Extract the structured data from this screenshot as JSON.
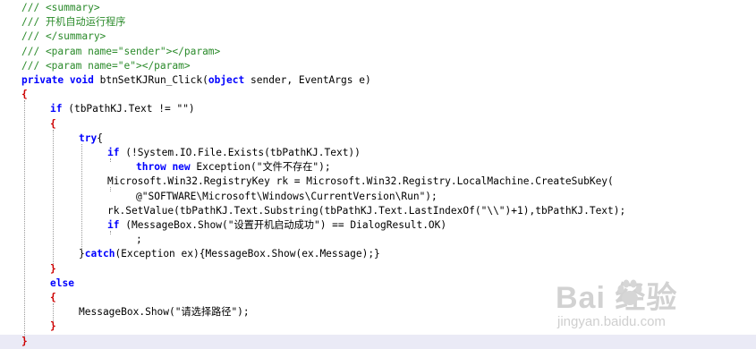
{
  "editor": {
    "lines": [
      "/// <summary>",
      "/// 开机自动运行程序",
      "/// </summary>",
      "/// <param name=\"sender\"></param>",
      "/// <param name=\"e\"></param>",
      "private void btnSetKJRun_Click(object sender, EventArgs e)",
      "{",
      "if (tbPathKJ.Text != \"\")",
      "{",
      "try{",
      "if (!System.IO.File.Exists(tbPathKJ.Text))",
      "throw new Exception(\"文件不存在\");",
      "Microsoft.Win32.RegistryKey rk = Microsoft.Win32.Registry.LocalMachine.CreateSubKey(",
      "@\"SOFTWARE\\Microsoft\\Windows\\CurrentVersion\\Run\");",
      "rk.SetValue(tbPathKJ.Text.Substring(tbPathKJ.Text.LastIndexOf(\"\\\\\")+1),tbPathKJ.Text);",
      "if (MessageBox.Show(\"设置开机启动成功\") == DialogResult.OK)",
      ";",
      "}catch(Exception ex){MessageBox.Show(ex.Message);}",
      "}",
      "else",
      "{",
      "MessageBox.Show(\"请选择路径\");",
      "}",
      "}"
    ],
    "colors": {
      "comment": "#2a8a2a",
      "keyword": "#0000ff",
      "brace": "#cc0000",
      "current_line": "#eaeaf6"
    }
  },
  "watermark": {
    "logo": "Bai  经验",
    "url": "jingyan.baidu.com",
    "icon": "paw-icon"
  }
}
